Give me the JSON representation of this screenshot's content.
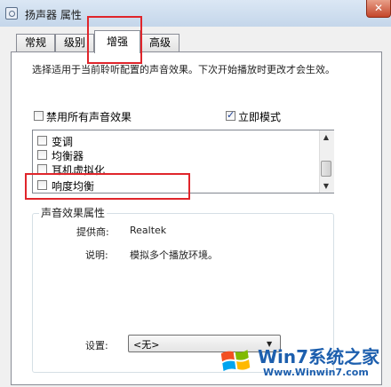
{
  "window": {
    "title": "扬声器 属性",
    "close_glyph": "✕"
  },
  "tabs": [
    {
      "label": "常规"
    },
    {
      "label": "级别"
    },
    {
      "label": "增强"
    },
    {
      "label": "高级"
    }
  ],
  "active_tab": "增强",
  "panel": {
    "description": "选择适用于当前聆听配置的声音效果。下次开始播放时更改才会生效。",
    "disable_all": {
      "label": "禁用所有声音效果",
      "checked": false
    },
    "immediate_mode": {
      "label": "立即模式",
      "checked": true
    },
    "effects": [
      {
        "label": "变调",
        "checked": false
      },
      {
        "label": "均衡器",
        "checked": false
      },
      {
        "label": "耳机虚拟化",
        "checked": false
      },
      {
        "label": "响度均衡",
        "checked": false
      }
    ],
    "properties": {
      "group_title": "声音效果属性",
      "provider_label": "提供商:",
      "provider_value": "Realtek",
      "desc_label": "说明:",
      "desc_value": "模拟多个播放环境。",
      "setting_label": "设置:",
      "setting_value": "<无>"
    }
  },
  "watermark": {
    "brand": "Win7系统之家",
    "url": "Www.Winwin7.com"
  },
  "colors": {
    "highlight": "#e0252b",
    "brand": "#1d5fae"
  }
}
